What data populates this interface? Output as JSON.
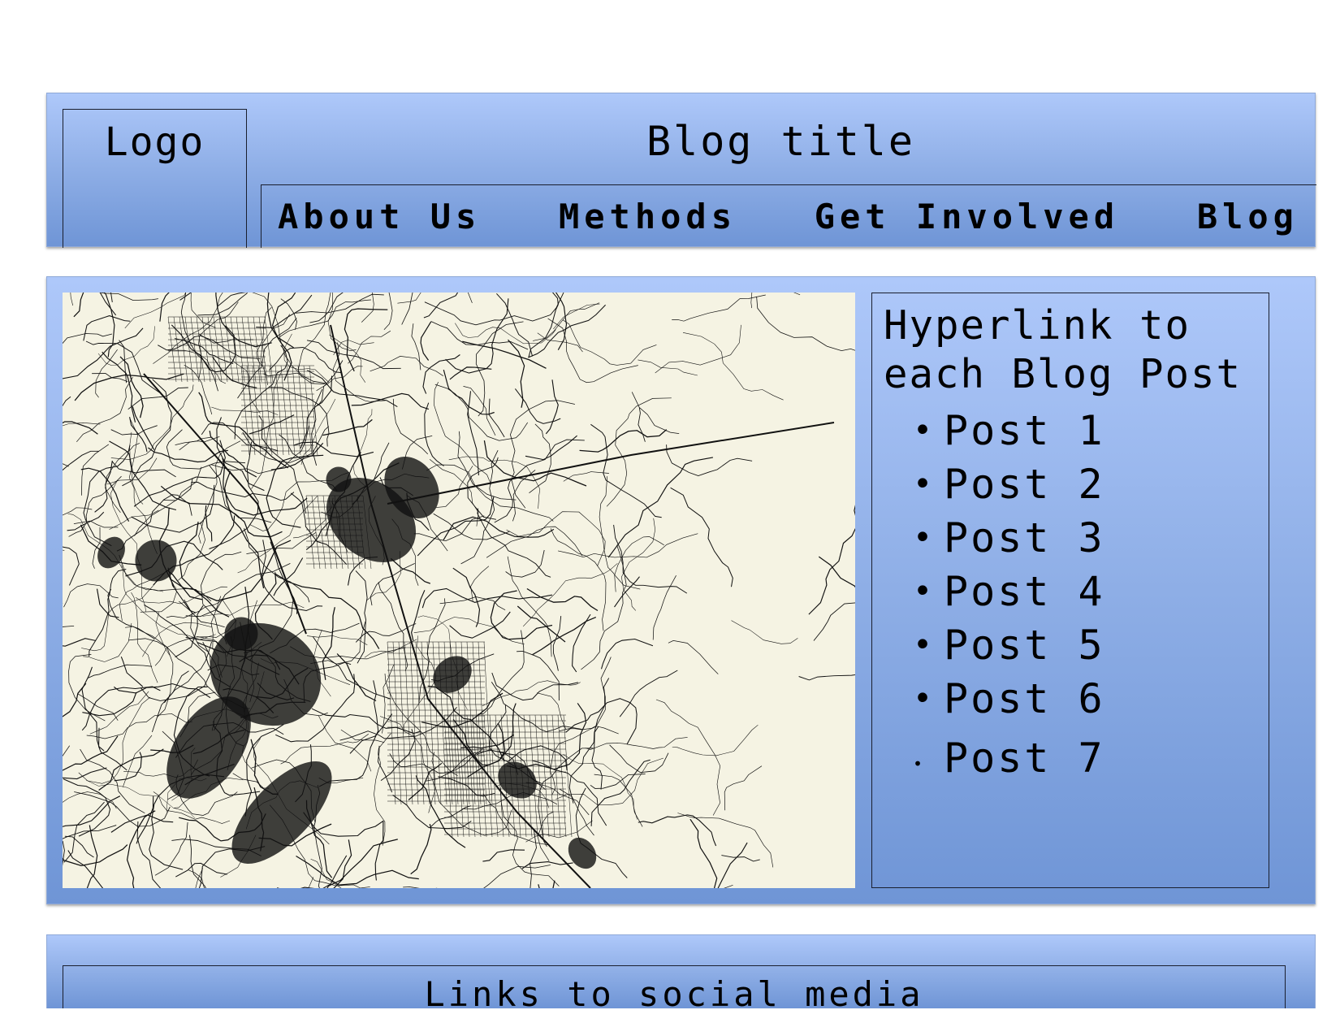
{
  "header": {
    "logo_label": "Logo",
    "blog_title": "Blog title",
    "nav": [
      {
        "label": "About Us"
      },
      {
        "label": "Methods"
      },
      {
        "label": "Get Involved"
      },
      {
        "label": "Blog"
      }
    ]
  },
  "main": {
    "map_colors": {
      "background": "#f5f3e3",
      "roads": "#111111"
    },
    "sidebar": {
      "heading_line1": "Hyperlink to",
      "heading_line2": "each Blog Post",
      "posts": [
        {
          "label": "Post 1"
        },
        {
          "label": "Post 2"
        },
        {
          "label": "Post 3"
        },
        {
          "label": "Post 4"
        },
        {
          "label": "Post 5"
        },
        {
          "label": "Post 6"
        },
        {
          "label": "Post 7"
        }
      ]
    }
  },
  "footer": {
    "social_label": "Links to social media"
  }
}
